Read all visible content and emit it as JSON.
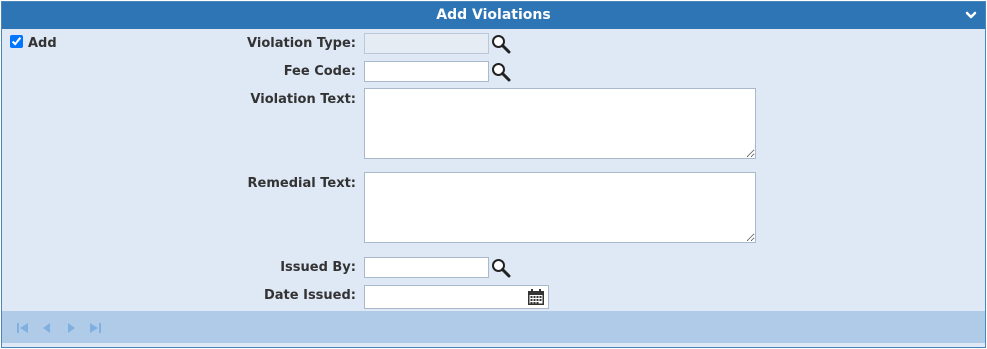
{
  "panel": {
    "title": "Add Violations",
    "collapse_icon": "chevron-down-icon"
  },
  "add": {
    "label": "Add",
    "checked": true
  },
  "fields": {
    "violation_type": {
      "label": "Violation Type:",
      "value": "",
      "icon": "search-icon"
    },
    "fee_code": {
      "label": "Fee Code:",
      "value": "",
      "icon": "search-icon"
    },
    "violation_text": {
      "label": "Violation Text:",
      "value": ""
    },
    "remedial_text": {
      "label": "Remedial Text:",
      "value": ""
    },
    "issued_by": {
      "label": "Issued By:",
      "value": "",
      "icon": "search-icon"
    },
    "date_issued": {
      "label": "Date Issued:",
      "value": "",
      "icon": "calendar-icon"
    }
  },
  "pager": {
    "icons": [
      "first-page-icon",
      "prev-page-icon",
      "next-page-icon",
      "last-page-icon"
    ],
    "color": "#7fb0e0"
  },
  "colors": {
    "header": "#2e75b6",
    "body": "#dfe8f5",
    "footer": "#b0cbe8"
  }
}
